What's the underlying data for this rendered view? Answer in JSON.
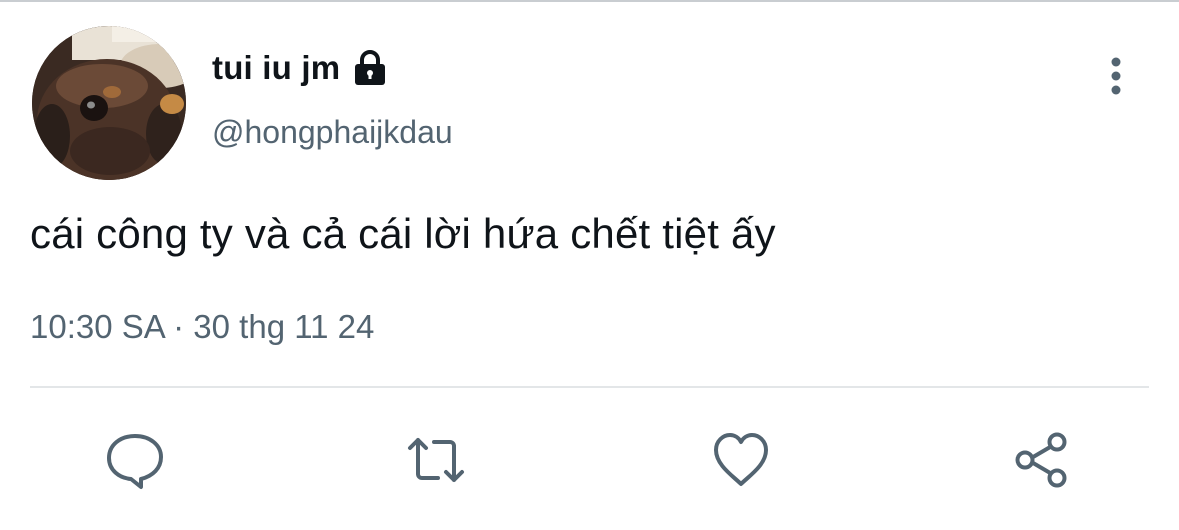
{
  "tweet": {
    "display_name": "tui iu jm",
    "handle": "@hongphaijkdau",
    "text": "cái công ty và cả cái lời hứa chết tiệt ấy",
    "time": "10:30 SA",
    "separator": "·",
    "date": "30 thg 11 24"
  },
  "icons": {
    "protected": "lock-icon",
    "more": "more-vertical-icon",
    "reply": "reply-icon",
    "retweet": "retweet-icon",
    "like": "heart-icon",
    "share": "share-icon"
  },
  "colors": {
    "text": "#0f1419",
    "secondary": "#536471",
    "icon": "#536471",
    "divider": "#e3e6e8"
  }
}
